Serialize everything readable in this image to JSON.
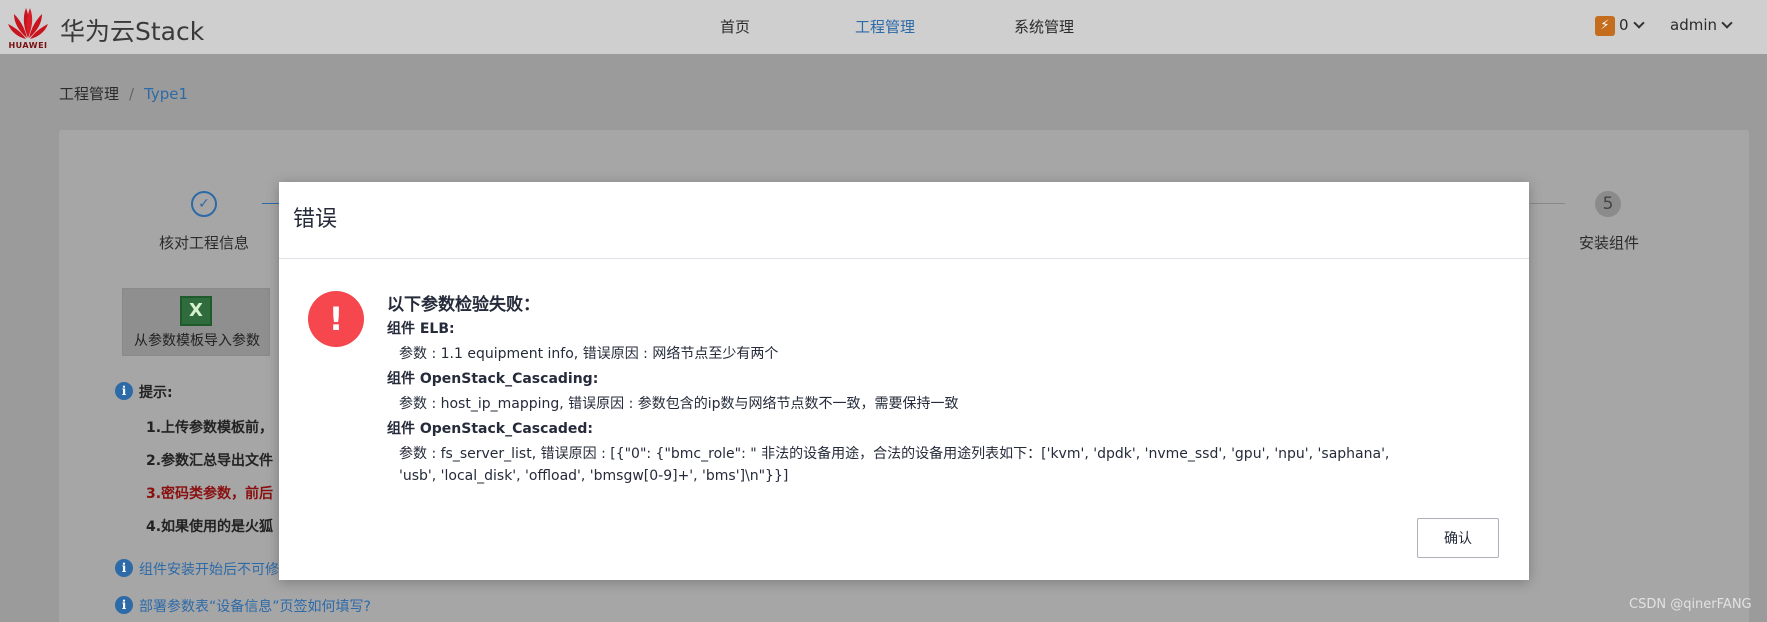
{
  "header": {
    "logo_text": "HUAWEI",
    "brand": "华为云Stack",
    "nav": [
      "首页",
      "工程管理",
      "系统管理"
    ],
    "active_nav": "工程管理",
    "notification_count": "0",
    "user": "admin"
  },
  "breadcrumb": {
    "root": "工程管理",
    "separator": "/",
    "current": "Type1"
  },
  "steps": {
    "first_label": "核对工程信息",
    "last_number": "5",
    "last_label": "安装组件"
  },
  "import_button": {
    "label": "从参数模板导入参数",
    "icon": "excel-icon"
  },
  "tips": {
    "title": "提示:",
    "items": [
      "1.上传参数模板前，",
      "2.参数汇总导出文件",
      "3.密码类参数，前后",
      "4.如果使用的是火狐"
    ]
  },
  "links": [
    "组件安装开始后不可修",
    "部署参数表“设备信息”页签如何填写?"
  ],
  "modal": {
    "title": "错误",
    "heading": "以下参数检验失败：",
    "components": [
      {
        "name": "组件 ELB:",
        "params": [
          "参数 : 1.1 equipment info, 错误原因 : 网络节点至少有两个"
        ]
      },
      {
        "name": "组件 OpenStack_Cascading:",
        "params": [
          "参数 : host_ip_mapping, 错误原因 : 参数包含的ip数与网络节点数不一致，需要保持一致"
        ]
      },
      {
        "name": "组件 OpenStack_Cascaded:",
        "params": [
          "参数 : fs_server_list, 错误原因 : [{\"0\": {\"bmc_role\": \" 非法的设备用途，合法的设备用途列表如下：['kvm', 'dpdk', 'nvme_ssd', 'gpu', 'npu', 'saphana',",
          "'usb', 'local_disk', 'offload', 'bmsgw[0-9]+', 'bms']\\n\"}}]"
        ]
      }
    ],
    "confirm": "确认"
  },
  "watermark": "CSDN @qinerFANG",
  "colors": {
    "accent": "#2d6aa8",
    "error": "#f6464e",
    "warning_red": "#8a1010",
    "lightning": "#c56d1e"
  }
}
